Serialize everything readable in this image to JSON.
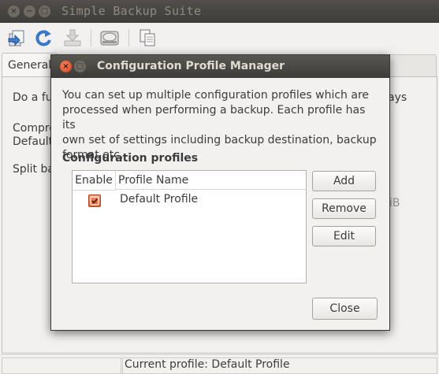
{
  "main_window": {
    "title": "Simple Backup Suite",
    "buttons": {
      "close": "×",
      "minimize": "−",
      "maximize": "□"
    },
    "toolbar": {
      "icons": [
        "open-icon",
        "refresh-icon",
        "save-icon",
        "backup-drive-icon",
        "copy-icon"
      ]
    },
    "tabs": [
      {
        "label": "General"
      }
    ],
    "content_fragments": {
      "line1": "Do a ful",
      "line1_right": "ays",
      "line2a": "Compre",
      "line2b": "Default",
      "line3": "Split ba",
      "line3_right": "iB"
    },
    "status": {
      "text": "Current profile: Default Profile"
    }
  },
  "dialog": {
    "title": "Configuration Profile Manager",
    "buttons": {
      "close": "×",
      "maximize": "□"
    },
    "description_lines": [
      "You can set up multiple configuration profiles which are",
      "processed when performing a backup. Each profile has its",
      "own set of settings including backup destination, backup",
      "format etc."
    ],
    "section_title": "Configuration profiles",
    "columns": [
      "Enable",
      "Profile Name"
    ],
    "profiles": [
      {
        "enabled": true,
        "name": "Default Profile"
      }
    ],
    "actions": {
      "add": "Add",
      "remove": "Remove",
      "edit": "Edit",
      "close": "Close"
    }
  },
  "colors": {
    "accent_orange": "#e05a27",
    "titlebar_dark": "#3d3b38",
    "window_bg": "#f2f1f0"
  }
}
